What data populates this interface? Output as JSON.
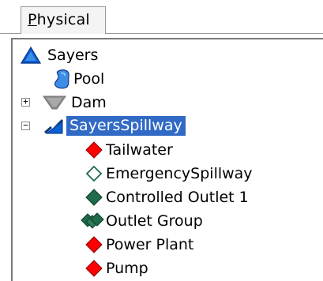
{
  "tab": {
    "label": "Physical"
  },
  "tree": {
    "root": {
      "label": "Sayers"
    },
    "pool": {
      "label": "Pool"
    },
    "dam": {
      "label": "Dam",
      "expander": "+"
    },
    "spillway": {
      "label": "SayersSpillway",
      "expander": "−"
    },
    "children": [
      {
        "label": "Tailwater",
        "icon": "red-diamond-icon",
        "color": "#ff0000"
      },
      {
        "label": "EmergencySpillway",
        "icon": "hollow-diamond-icon",
        "color": "#1f6b4a"
      },
      {
        "label": "Controlled Outlet 1",
        "icon": "green-diamond-icon",
        "color": "#1f6b4a"
      },
      {
        "label": "Outlet Group",
        "icon": "diamond-group-icon",
        "color": "#1f6b4a"
      },
      {
        "label": "Power Plant",
        "icon": "red-diamond-icon",
        "color": "#ff0000"
      },
      {
        "label": "Pump",
        "icon": "red-diamond-icon",
        "color": "#ff0000"
      }
    ]
  },
  "colors": {
    "selection": "#316ac5",
    "root_icon_fill": "#0b5fd6",
    "pool_icon_fill": "#3c8de6",
    "dam_icon_fill": "#8e8e8e"
  }
}
